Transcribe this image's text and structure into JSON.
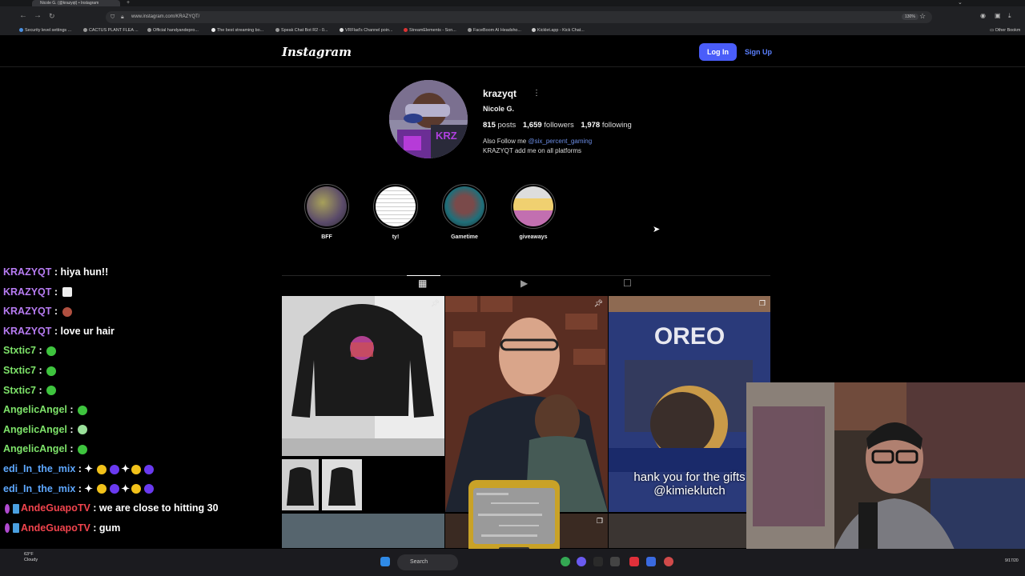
{
  "browser": {
    "tab_title": "Nicole G. (@krazyqt) • Instagram",
    "url": "www.instagram.com/KRAZYQT/",
    "zoom": "130%",
    "bookmarks": [
      "Security level settings ...",
      "CACTUS PLANT FLEA ...",
      "Official handyandepro...",
      "The best streaming bo...",
      "Speak Chat Bot R2 - 0...",
      "VRFlad's Channel poin...",
      "StreamElements - Son...",
      "FaceBoom AI Headsho...",
      "Kicklet.app - Kick Chat..."
    ],
    "other_bookmarks": "Other Bookm"
  },
  "instagram": {
    "logo": "Instagram",
    "login_label": "Log In",
    "signup_label": "Sign Up",
    "username": "krazyqt",
    "full_name": "Nicole G.",
    "posts_count": "815",
    "posts_label": "posts",
    "followers_count": "1,659",
    "followers_label": "followers",
    "following_count": "1,978",
    "following_label": "following",
    "bio_line1_prefix": "Also Follow me ",
    "bio_mention": "@six_percent_gaming",
    "bio_line2": "KRAZYQT add me on all platforms",
    "highlights": [
      {
        "label": "BFF"
      },
      {
        "label": "ty!"
      },
      {
        "label": "Gametime"
      },
      {
        "label": "giveaways"
      }
    ],
    "post_caption_overlay": "hank you for the gifts",
    "post_caption_handle": "@kimieklutch",
    "oreo_brand": "OREO"
  },
  "chat": [
    {
      "user": "KRAZYQT",
      "color": "#b77cf2",
      "msg": "hiya hun!!"
    },
    {
      "user": "KRAZYQT",
      "color": "#b77cf2",
      "msg": ""
    },
    {
      "user": "KRAZYQT",
      "color": "#b77cf2",
      "msg": ""
    },
    {
      "user": "KRAZYQT",
      "color": "#b77cf2",
      "msg": "love ur hair"
    },
    {
      "user": "Stxtic7",
      "color": "#7ee36a",
      "msg": ""
    },
    {
      "user": "Stxtic7",
      "color": "#7ee36a",
      "msg": ""
    },
    {
      "user": "Stxtic7",
      "color": "#7ee36a",
      "msg": ""
    },
    {
      "user": "AngelicAngel",
      "color": "#7ee36a",
      "msg": ""
    },
    {
      "user": "AngelicAngel",
      "color": "#7ee36a",
      "msg": ""
    },
    {
      "user": "AngelicAngel",
      "color": "#7ee36a",
      "msg": ""
    },
    {
      "user": "edi_In_the_mix",
      "color": "#5ea8ff",
      "msg": ""
    },
    {
      "user": "edi_In_the_mix",
      "color": "#5ea8ff",
      "msg": ""
    },
    {
      "user": "AndeGuapoTV",
      "color": "#f0444d",
      "msg": "we are close to hitting 30"
    },
    {
      "user": "AndeGuapoTV",
      "color": "#f0444d",
      "msg": "gum"
    }
  ],
  "taskbar": {
    "search_label": "Search",
    "weather_temp": "63°F",
    "weather_desc": "Cloudy",
    "clock": "9/17/20"
  }
}
